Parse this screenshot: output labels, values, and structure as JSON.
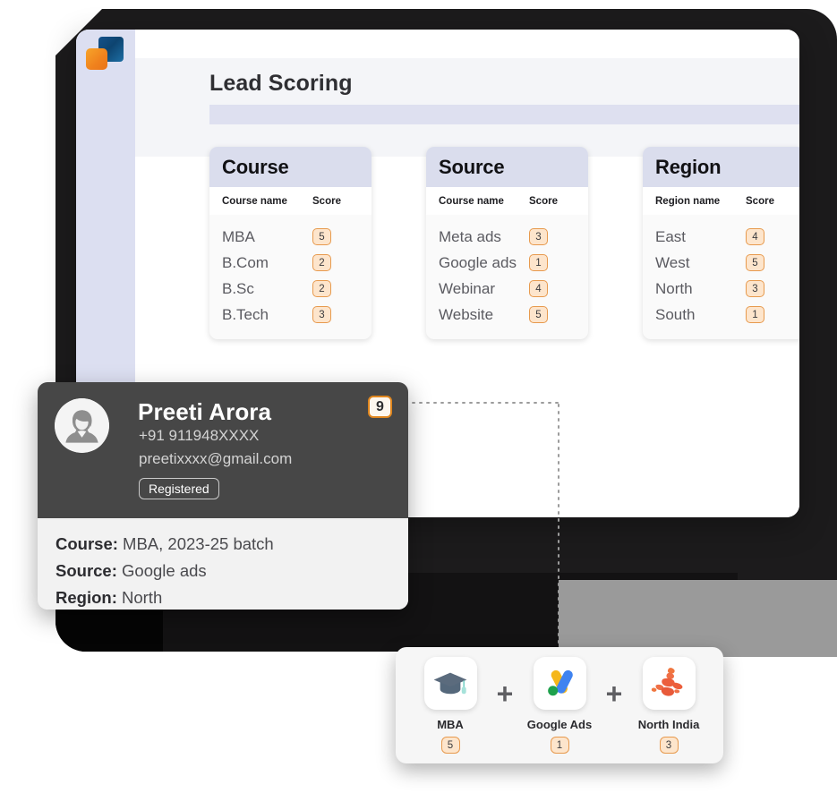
{
  "app": {
    "logo_icon": "stacked-squares-logo",
    "page_title": "Lead Scoring"
  },
  "score_cards": [
    {
      "title": "Course",
      "name_column": "Course name",
      "score_column": "Score",
      "rows": [
        {
          "name": "MBA",
          "score": "5"
        },
        {
          "name": "B.Com",
          "score": "2"
        },
        {
          "name": "B.Sc",
          "score": "2"
        },
        {
          "name": "B.Tech",
          "score": "3"
        }
      ]
    },
    {
      "title": "Source",
      "name_column": "Course name",
      "score_column": "Score",
      "rows": [
        {
          "name": "Meta ads",
          "score": "3"
        },
        {
          "name": "Google ads",
          "score": "1"
        },
        {
          "name": "Webinar",
          "score": "4"
        },
        {
          "name": "Website",
          "score": "5"
        }
      ]
    },
    {
      "title": "Region",
      "name_column": "Region name",
      "score_column": "Score",
      "rows": [
        {
          "name": "East",
          "score": "4"
        },
        {
          "name": "West",
          "score": "5"
        },
        {
          "name": "North",
          "score": "3"
        },
        {
          "name": "South",
          "score": "1"
        }
      ]
    }
  ],
  "profile": {
    "avatar_icon": "person-avatar-icon",
    "name": "Preeti Arora",
    "phone": "+91 911948XXXX",
    "email": "preetixxxx@gmail.com",
    "status_tag": "Registered",
    "total_score": "9",
    "details": [
      {
        "label": "Course:",
        "value": "MBA, 2023-25 batch"
      },
      {
        "label": "Source:",
        "value": "Google ads"
      },
      {
        "label": "Region:",
        "value": "North"
      }
    ]
  },
  "formula": {
    "operator": "+",
    "items": [
      {
        "icon": "graduation-cap-icon",
        "label": "MBA",
        "score": "5"
      },
      {
        "icon": "google-ads-icon",
        "label": "Google Ads",
        "score": "1"
      },
      {
        "icon": "north-india-map-icon",
        "label": "North India",
        "score": "3"
      }
    ]
  },
  "colors": {
    "accent_orange": "#e79a4e",
    "badge_bg": "#fde5cc",
    "sidebar": "#dcdff1",
    "card_head": "#dadded",
    "profile_dark": "#474747"
  }
}
